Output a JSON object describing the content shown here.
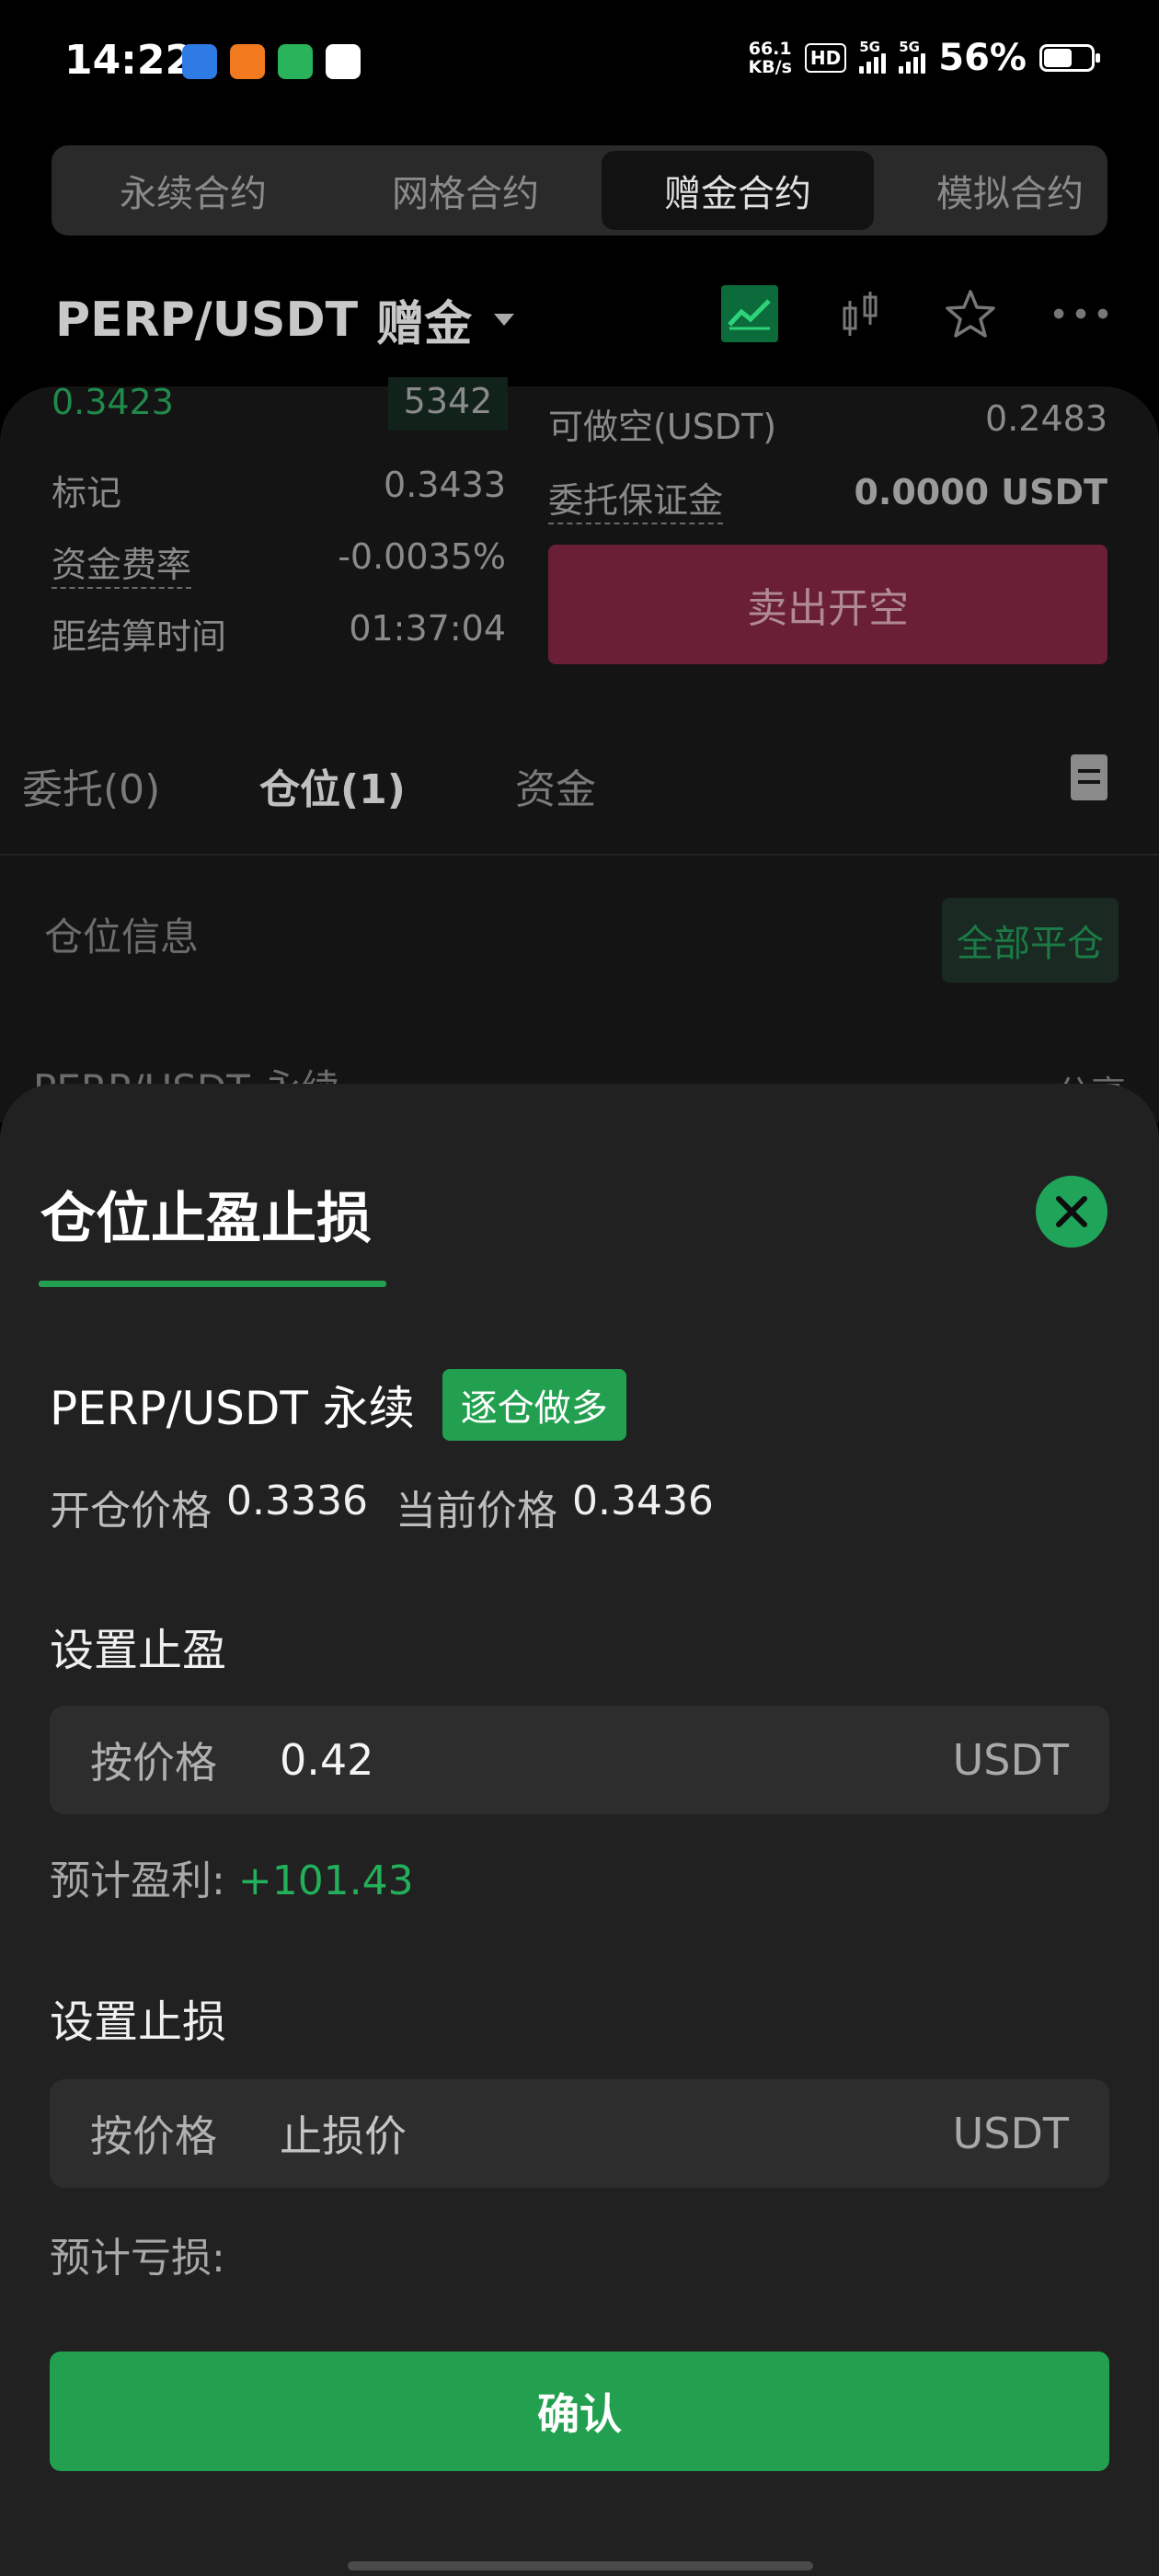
{
  "status_bar": {
    "time": "14:22",
    "net_speed_value": "66.1",
    "net_speed_unit": "KB/s",
    "hd_badge": "HD",
    "signal1_label": "5G",
    "signal2_label": "5G",
    "battery_percent": "56%",
    "battery_level": 0.56
  },
  "tabs": [
    {
      "label": "永续合约"
    },
    {
      "label": "网格合约"
    },
    {
      "label": "赠金合约"
    },
    {
      "label": "模拟合约"
    }
  ],
  "active_tab": 2,
  "pair": {
    "name": "PERP/USDT",
    "type": "赠金"
  },
  "market": {
    "last_price": "0.3423",
    "depth_value": "5342",
    "mark_label": "标记",
    "mark_value": "0.3433",
    "funding_label": "资金费率",
    "funding_value": "-0.0035%",
    "settle_label": "距结算时间",
    "settle_value": "01:37:04"
  },
  "order_panel": {
    "short_avail_label": "可做空(USDT)",
    "short_avail_value": "0.2483",
    "margin_label": "委托保证金",
    "margin_value": "0.0000 USDT",
    "sell_button": "卖出开空"
  },
  "sub_tabs": [
    {
      "label": "委托(0)"
    },
    {
      "label": "仓位(1)"
    },
    {
      "label": "资金"
    }
  ],
  "positions": {
    "header": "仓位信息",
    "close_all": "全部平仓",
    "row_name": "PERP/USDT 永续",
    "share": "分享"
  },
  "sheet": {
    "title": "仓位止盈止损",
    "symbol": "PERP/USDT 永续",
    "side_tag": "逐仓做多",
    "open_price_label": "开仓价格",
    "open_price": "0.3336",
    "current_price_label": "当前价格",
    "current_price": "0.3436",
    "tp_label": "设置止盈",
    "tp_mode": "按价格",
    "tp_value": "0.42",
    "tp_unit": "USDT",
    "tp_est_label": "预计盈利:",
    "tp_est_value": "+101.43",
    "sl_label": "设置止损",
    "sl_mode": "按价格",
    "sl_placeholder": "止损价",
    "sl_unit": "USDT",
    "sl_est_label": "预计亏损:",
    "confirm": "确认"
  },
  "colors": {
    "accent_green": "#22a04f",
    "sell_red": "#6a1f36",
    "profit_green": "#23b05a"
  }
}
